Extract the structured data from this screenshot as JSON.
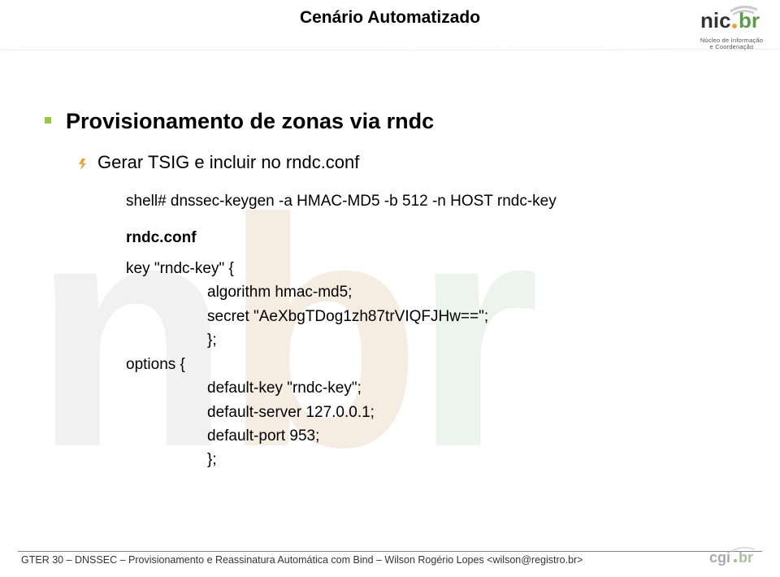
{
  "header": {
    "title": "Cenário Automatizado"
  },
  "logo": {
    "main": "nic.br",
    "sub1": "Núcleo de Informação",
    "sub2": "e Coordenação"
  },
  "content": {
    "heading": "Provisionamento de zonas via rndc",
    "sub": "Gerar TSIG e incluir no rndc.conf",
    "shell_line": "shell# dnssec-keygen -a HMAC-MD5 -b 512 -n HOST rndc-key",
    "conf_label": "rndc.conf",
    "key_open": "key \"rndc-key\" {",
    "algo": "algorithm hmac-md5;",
    "secret": "secret \"AeXbgTDog1zh87trVIQFJHw==\";",
    "brace1": "};",
    "options_open": "options {",
    "default_key": "default-key \"rndc-key\";",
    "default_server": "default-server 127.0.0.1;",
    "default_port": "default-port 953;",
    "brace2": "};"
  },
  "footer": {
    "text": "GTER 30 – DNSSEC – Provisionamento e Reassinatura Automática com Bind – Wilson Rogério Lopes <wilson@registro.br>"
  }
}
